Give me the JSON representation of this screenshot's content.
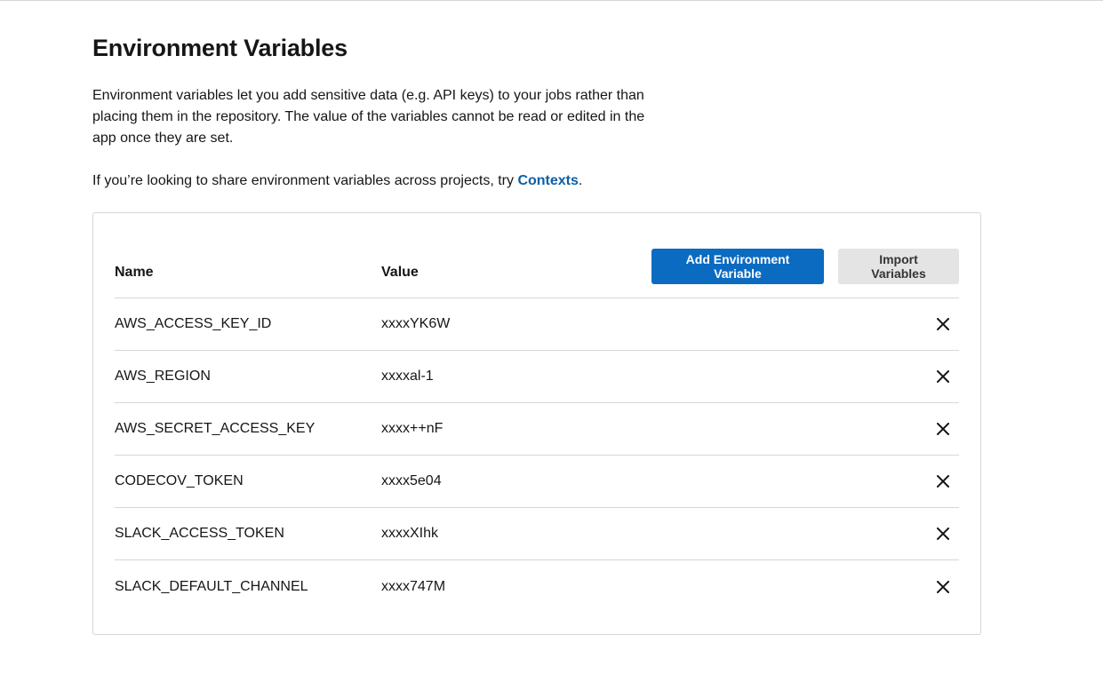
{
  "page": {
    "title": "Environment Variables",
    "intro": "Environment variables let you add sensitive data (e.g. API keys) to your jobs rather than placing them in the repository. The value of the variables cannot be read or edited in the app once they are set.",
    "share_prefix": "If you’re looking to share environment variables across projects, try ",
    "share_link": "Contexts",
    "share_suffix": "."
  },
  "table": {
    "name_header": "Name",
    "value_header": "Value",
    "add_button": "Add Environment Variable",
    "import_button": "Import Variables",
    "rows": [
      {
        "name": "AWS_ACCESS_KEY_ID",
        "value": "xxxxYK6W"
      },
      {
        "name": "AWS_REGION",
        "value": "xxxxal-1"
      },
      {
        "name": "AWS_SECRET_ACCESS_KEY",
        "value": "xxxx++nF"
      },
      {
        "name": "CODECOV_TOKEN",
        "value": "xxxx5e04"
      },
      {
        "name": "SLACK_ACCESS_TOKEN",
        "value": "xxxxXIhk"
      },
      {
        "name": "SLACK_DEFAULT_CHANNEL",
        "value": "xxxx747M"
      }
    ]
  },
  "icons": {
    "delete": "close-icon"
  },
  "colors": {
    "primary": "#0b6bc1",
    "link": "#0b5fa5",
    "secondary_button": "#e4e4e4",
    "border": "#d6d6d6"
  }
}
